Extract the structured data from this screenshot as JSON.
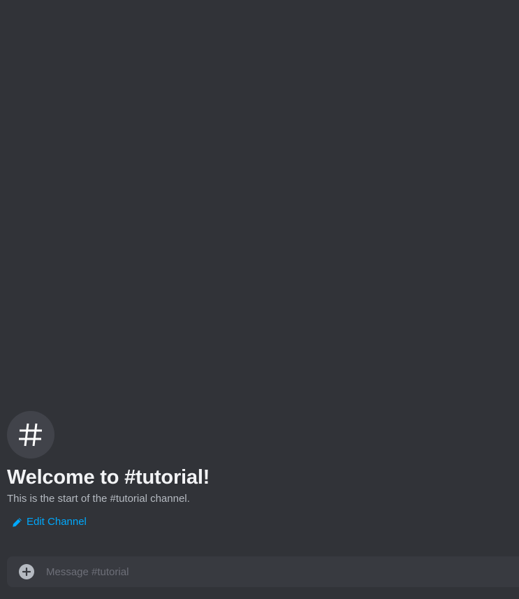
{
  "welcome": {
    "title": "Welcome to #tutorial!",
    "subtitle": "This is the start of the #tutorial channel.",
    "edit_channel_label": "Edit Channel",
    "channel_icon": "hashtag-icon"
  },
  "composer": {
    "placeholder": "Message #tutorial",
    "value": "",
    "attach_icon": "plus-circle-icon"
  },
  "colors": {
    "background": "#313338",
    "link": "#00a8fc",
    "heading": "#f2f3f5",
    "muted": "#b5bac1"
  }
}
